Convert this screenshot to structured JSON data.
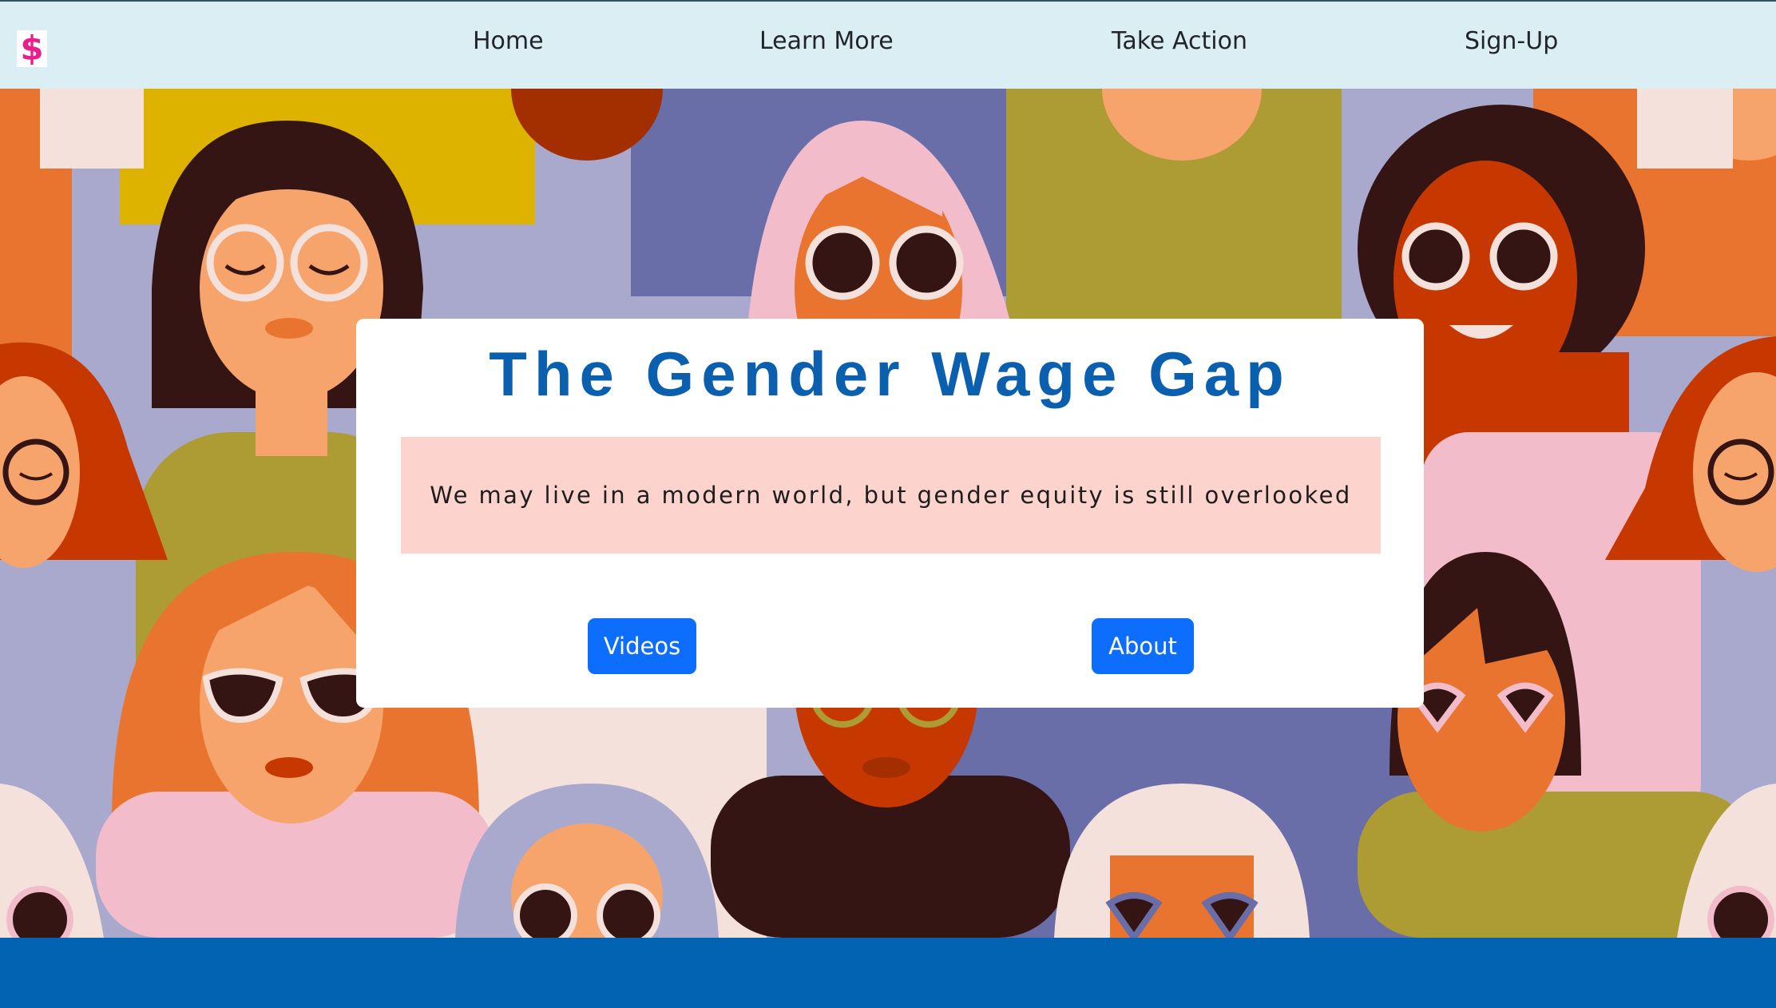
{
  "nav": {
    "logo_symbol": "$",
    "links": [
      {
        "label": "Home"
      },
      {
        "label": "Learn More"
      },
      {
        "label": "Take Action"
      },
      {
        "label": "Sign-Up"
      }
    ]
  },
  "card": {
    "title": "The Gender Wage Gap",
    "subtitle": "We may live in a modern world, but gender equity is still overlooked",
    "buttons": {
      "videos": "Videos",
      "about": "About"
    }
  },
  "colors": {
    "navbar_bg": "#dbeef3",
    "title": "#0a5fae",
    "subtitle_bg": "#fdd3cd",
    "button": "#0d6efd",
    "footer_band": "#0263b3",
    "logo": "#e91e8c"
  }
}
